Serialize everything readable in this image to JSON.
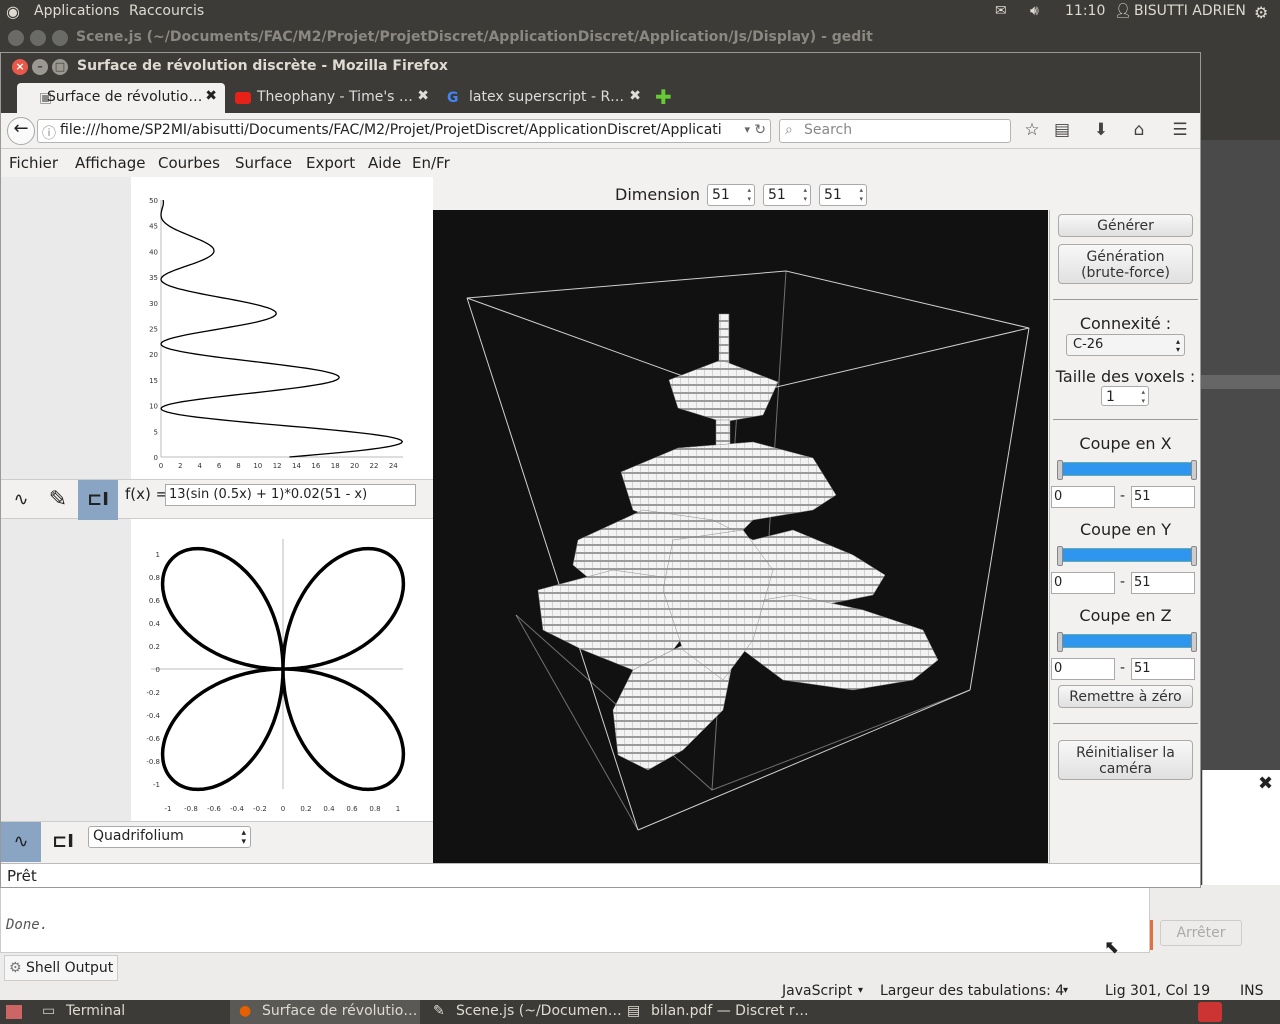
{
  "topbar": {
    "apps": "Applications",
    "shortcuts": "Raccourcis",
    "time": "11:10",
    "user": "BISUTTI ADRIEN"
  },
  "gedit": {
    "title": "Scene.js (~/Documents/FAC/M2/Projet/ProjetDiscret/ApplicationDiscret/Application/Js/Display) - gedit",
    "done": "Done.",
    "stop": "Arrêter",
    "shell": "Shell Output",
    "lang": "JavaScript",
    "tabwidth": "Largeur des tabulations:  4",
    "position": "Lig 301, Col 19",
    "ins": "INS"
  },
  "firefox": {
    "title": "Surface de révolution discrète - Mozilla Firefox",
    "tabs": [
      {
        "label": "Surface de révolutio…"
      },
      {
        "label": "Theophany - Time's …"
      },
      {
        "label": "latex superscript - R…"
      }
    ],
    "url": "file:///home/SP2MI/abisutti/Documents/FAC/M2/Projet/ProjetDiscret/ApplicationDiscret/Applicati",
    "search_placeholder": "Search"
  },
  "menu": [
    "Fichier",
    "Affichage",
    "Courbes",
    "Surface",
    "Export",
    "Aide",
    "En/Fr"
  ],
  "dimension": {
    "label": "Dimension :",
    "x": "51",
    "y": "51",
    "z": "51"
  },
  "profile": {
    "fx_label": "f(x) =",
    "fx_value": "13(sin (0.5x) + 1)*0.02(51 - x)"
  },
  "curve": {
    "selected": "Quadrifolium"
  },
  "controls": {
    "generate": "Générer",
    "brute": "Génération (brute-force)",
    "connex_label": "Connexité :",
    "connex": "C-26",
    "voxel_label": "Taille des voxels :",
    "voxel": "1",
    "cut_x": "Coupe en X",
    "cut_y": "Coupe en Y",
    "cut_z": "Coupe en Z",
    "min": "0",
    "max": "51",
    "reset": "Remettre à zéro",
    "reset_cam": "Réinitialiser la caméra"
  },
  "status": "Prêt",
  "taskbar": [
    "Terminal",
    "Surface de révolutio…",
    "Scene.js (~/Documen…",
    "bilan.pdf — Discret r…"
  ],
  "chart_data": [
    {
      "type": "line",
      "title": "",
      "xlim": [
        0,
        25
      ],
      "ylim": [
        0,
        50
      ],
      "xticks": [
        0,
        2,
        4,
        6,
        8,
        10,
        12,
        14,
        16,
        18,
        20,
        22,
        24
      ],
      "yticks": [
        0,
        5,
        10,
        15,
        20,
        25,
        30,
        35,
        40,
        45,
        50
      ]
    },
    {
      "type": "line",
      "title": "",
      "xlim": [
        -1,
        1
      ],
      "ylim": [
        -1,
        1
      ],
      "xticks": [
        "-1",
        "-0.8",
        "-0.6",
        "-0.4",
        "-0.2",
        "0",
        "0.2",
        "0.4",
        "0.6",
        "0.8",
        "1"
      ],
      "yticks": [
        "1",
        "0.8",
        "0.6",
        "0.4",
        "0.2",
        "0",
        "-0.2",
        "-0.4",
        "-0.6",
        "-0.8",
        "-1"
      ]
    }
  ]
}
